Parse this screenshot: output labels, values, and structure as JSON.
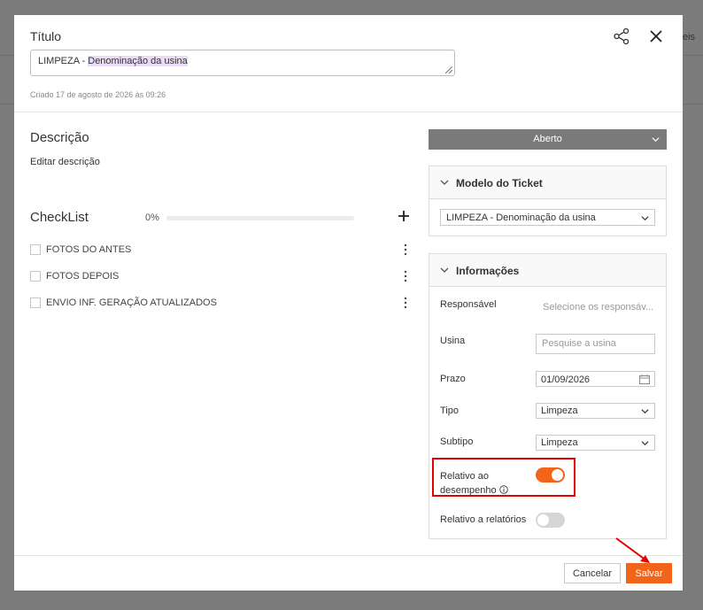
{
  "backdrop": {
    "partial_text": "eis"
  },
  "header": {
    "title_label": "Título",
    "title_prefix": "LIMPEZA - ",
    "title_highlight": "Denominação da usina",
    "created_text": "Criado 17 de agosto de 2026 às 09:26"
  },
  "description": {
    "heading": "Descrição",
    "edit_link": "Editar descrição"
  },
  "checklist": {
    "heading": "CheckList",
    "progress_text": "0%",
    "progress_fraction": 0,
    "items": [
      {
        "label": "FOTOS DO ANTES"
      },
      {
        "label": "FOTOS DEPOIS"
      },
      {
        "label": "ENVIO INF. GERAÇÃO ATUALIZADOS"
      }
    ]
  },
  "status": {
    "value": "Aberto"
  },
  "ticket_model": {
    "heading": "Modelo do Ticket",
    "selected": "LIMPEZA - Denominação da usina"
  },
  "info": {
    "heading": "Informações",
    "responsavel_label": "Responsável",
    "responsavel_placeholder": "Selecione os responsáv...",
    "usina_label": "Usina",
    "usina_placeholder": "Pesquise a usina",
    "prazo_label": "Prazo",
    "prazo_value": "01/09/2026",
    "tipo_label": "Tipo",
    "tipo_value": "Limpeza",
    "subtipo_label": "Subtipo",
    "subtipo_value": "Limpeza",
    "desempenho_label_line1": "Relativo ao",
    "desempenho_label_line2": "desempenho",
    "desempenho_on": true,
    "relatorios_label": "Relativo a relatórios",
    "relatorios_on": false
  },
  "footer": {
    "cancel_label": "Cancelar",
    "save_label": "Salvar"
  },
  "colors": {
    "accent": "#f26419",
    "annotation": "#e30000",
    "status_bg": "#7a7a7a"
  }
}
